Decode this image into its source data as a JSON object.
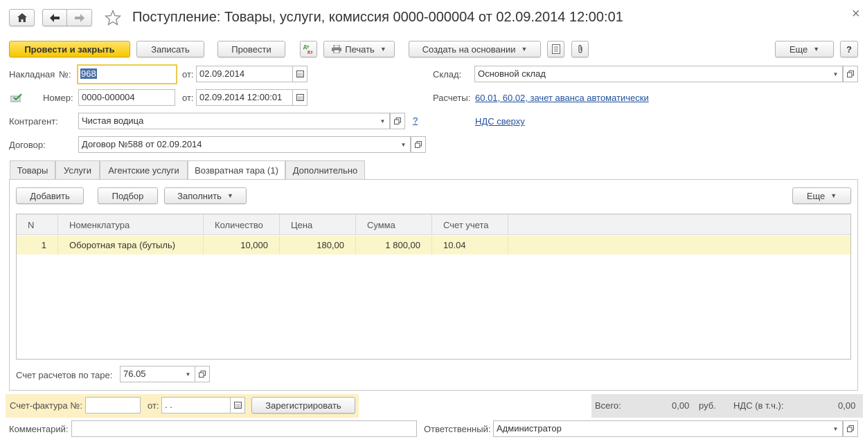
{
  "title": "Поступление: Товары, услуги, комиссия 0000-000004 от 02.09.2014 12:00:01",
  "nav": {
    "home_icon": "home-icon",
    "back_icon": "arrow-left-icon",
    "forward_icon": "arrow-right-icon",
    "star_icon": "star-icon"
  },
  "window": {
    "close_glyph": "×"
  },
  "toolbar": {
    "post_close": "Провести и закрыть",
    "save": "Записать",
    "post": "Провести",
    "dtkt_icon": "dt-kt-icon",
    "print": "Печать",
    "create_based_on": "Создать на основании",
    "more": "Еще",
    "help": "?"
  },
  "header": {
    "invoice_label": "Накладная",
    "number_sign": "№:",
    "invoice_number": "968",
    "from_label": "от:",
    "invoice_date": "02.09.2014",
    "number_label": "Номер:",
    "doc_number": "0000-000004",
    "doc_datetime": "02.09.2014 12:00:01",
    "warehouse_label": "Склад:",
    "warehouse": "Основной склад",
    "settlements_label": "Расчеты:",
    "settlements_link": "60.01, 60.02, зачет аванса автоматически",
    "vat_link": "НДС сверху",
    "counterparty_label": "Контрагент:",
    "counterparty": "Чистая водица",
    "question_link": "?",
    "contract_label": "Договор:",
    "contract": "Договор №588 от 02.09.2014"
  },
  "tabs": [
    {
      "label": "Товары"
    },
    {
      "label": "Услуги"
    },
    {
      "label": "Агентские услуги"
    },
    {
      "label": "Возвратная тара (1)"
    },
    {
      "label": "Дополнительно"
    }
  ],
  "table_toolbar": {
    "add": "Добавить",
    "pick": "Подбор",
    "fill": "Заполнить",
    "more": "Еще"
  },
  "table": {
    "columns": [
      "N",
      "Номенклатура",
      "Количество",
      "Цена",
      "Сумма",
      "Счет учета"
    ],
    "rows": [
      {
        "n": "1",
        "item": "Оборотная тара (бутыль)",
        "qty": "10,000",
        "price": "180,00",
        "sum": "1 800,00",
        "account": "10.04"
      }
    ]
  },
  "container_account": {
    "label": "Счет расчетов по таре:",
    "value": "76.05"
  },
  "invoice": {
    "label": "Счет-фактура №:",
    "number": "",
    "from_label": "от:",
    "date": " .  .",
    "register": "Зарегистрировать"
  },
  "totals": {
    "total_label": "Всего:",
    "total": "0,00",
    "currency": "руб.",
    "vat_label": "НДС (в т.ч.):",
    "vat": "0,00"
  },
  "footer": {
    "comment_label": "Комментарий:",
    "comment": "",
    "responsible_label": "Ответственный:",
    "responsible": "Администратор"
  },
  "colors": {
    "accent_yellow": "#f5c800",
    "row_highlight": "#fbf6c9",
    "link": "#1f4f9c",
    "invoice_bg": "#fdf0c4"
  }
}
